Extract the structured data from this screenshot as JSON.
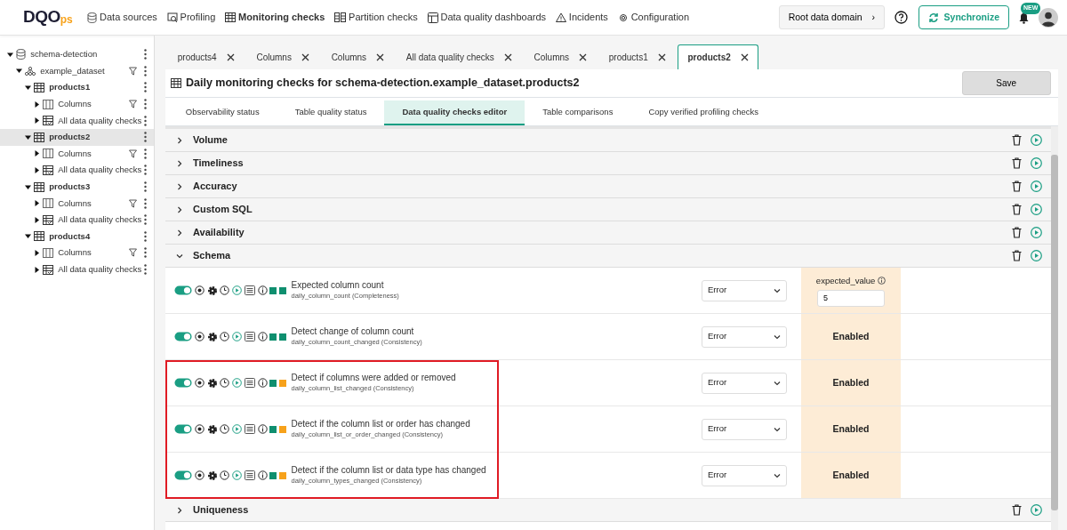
{
  "logo": {
    "main": "DQO",
    "suffix": "ps"
  },
  "nav": [
    {
      "label": "Data sources",
      "selected": false
    },
    {
      "label": "Profiling",
      "selected": false
    },
    {
      "label": "Monitoring checks",
      "selected": true
    },
    {
      "label": "Partition checks",
      "selected": false
    },
    {
      "label": "Data quality dashboards",
      "selected": false
    },
    {
      "label": "Incidents",
      "selected": false
    },
    {
      "label": "Configuration",
      "selected": false
    }
  ],
  "domain_button": {
    "label": "Root data domain",
    "arrow": "›"
  },
  "sync_button": "Synchronize",
  "notification_badge": "NEW",
  "tree": [
    {
      "kind": "connection",
      "label": "schema-detection",
      "expanded": true,
      "selected": false,
      "filter": false,
      "children": [
        {
          "kind": "schema",
          "label": "example_dataset",
          "expanded": true,
          "selected": false,
          "filter": true,
          "children": [
            {
              "kind": "table",
              "label": "products1",
              "expanded": true,
              "selected": false,
              "filter": false,
              "children": [
                {
                  "kind": "columns",
                  "label": "Columns",
                  "expanded": false,
                  "selected": false,
                  "filter": true
                },
                {
                  "kind": "checks",
                  "label": "All data quality checks",
                  "expanded": false,
                  "selected": false,
                  "filter": false
                }
              ]
            },
            {
              "kind": "table",
              "label": "products2",
              "expanded": true,
              "selected": true,
              "filter": false,
              "children": [
                {
                  "kind": "columns",
                  "label": "Columns",
                  "expanded": false,
                  "selected": false,
                  "filter": true
                },
                {
                  "kind": "checks",
                  "label": "All data quality checks",
                  "expanded": false,
                  "selected": false,
                  "filter": false
                }
              ]
            },
            {
              "kind": "table",
              "label": "products3",
              "expanded": true,
              "selected": false,
              "filter": false,
              "children": [
                {
                  "kind": "columns",
                  "label": "Columns",
                  "expanded": false,
                  "selected": false,
                  "filter": true
                },
                {
                  "kind": "checks",
                  "label": "All data quality checks",
                  "expanded": false,
                  "selected": false,
                  "filter": false
                }
              ]
            },
            {
              "kind": "table",
              "label": "products4",
              "expanded": true,
              "selected": false,
              "filter": false,
              "children": [
                {
                  "kind": "columns",
                  "label": "Columns",
                  "expanded": false,
                  "selected": false,
                  "filter": true
                },
                {
                  "kind": "checks",
                  "label": "All data quality checks",
                  "expanded": false,
                  "selected": false,
                  "filter": false
                }
              ]
            }
          ]
        }
      ]
    }
  ],
  "tabs": [
    {
      "label": "products4",
      "selected": false
    },
    {
      "label": "Columns",
      "selected": false
    },
    {
      "label": "Columns",
      "selected": false
    },
    {
      "label": "All data quality checks",
      "selected": false
    },
    {
      "label": "Columns",
      "selected": false
    },
    {
      "label": "products1",
      "selected": false
    },
    {
      "label": "products2",
      "selected": true
    }
  ],
  "page_title": "Daily monitoring checks for schema-detection.example_dataset.products2",
  "save_button": "Save",
  "sub_tabs": [
    {
      "label": "Observability status",
      "selected": false
    },
    {
      "label": "Table quality status",
      "selected": false
    },
    {
      "label": "Data quality checks editor",
      "selected": true
    },
    {
      "label": "Table comparisons",
      "selected": false
    },
    {
      "label": "Copy verified profiling checks",
      "selected": false
    }
  ],
  "categories": [
    {
      "name": "Volume",
      "expanded": false
    },
    {
      "name": "Timeliness",
      "expanded": false
    },
    {
      "name": "Accuracy",
      "expanded": false
    },
    {
      "name": "Custom SQL",
      "expanded": false
    },
    {
      "name": "Availability",
      "expanded": false
    },
    {
      "name": "Schema",
      "expanded": true,
      "checks": [
        {
          "title": "Expected column count",
          "subtitle": "daily_column_count (Completeness)",
          "enabled": true,
          "highlighted": false,
          "status_colors": [
            {
              "color": "#0f8f6f"
            },
            {
              "color": "#0f8f6f"
            }
          ],
          "severity": "Error",
          "rule": {
            "kind": "parameter",
            "label": "expected_value",
            "value": "5"
          }
        },
        {
          "title": "Detect change of column count",
          "subtitle": "daily_column_count_changed (Consistency)",
          "enabled": true,
          "highlighted": false,
          "status_colors": [
            {
              "color": "#0f8f6f"
            },
            {
              "color": "#0f8f6f"
            }
          ],
          "severity": "Error",
          "rule": {
            "kind": "flag",
            "text": "Enabled"
          }
        },
        {
          "title": "Detect if columns were added or removed",
          "subtitle": "daily_column_list_changed (Consistency)",
          "enabled": true,
          "highlighted": true,
          "status_colors": [
            {
              "color": "#0f8f6f"
            },
            {
              "color": "#f7a21b"
            }
          ],
          "severity": "Error",
          "rule": {
            "kind": "flag",
            "text": "Enabled"
          }
        },
        {
          "title": "Detect if the column list or order has changed",
          "subtitle": "daily_column_list_or_order_changed (Consistency)",
          "enabled": true,
          "highlighted": true,
          "status_colors": [
            {
              "color": "#0f8f6f"
            },
            {
              "color": "#f7a21b"
            }
          ],
          "severity": "Error",
          "rule": {
            "kind": "flag",
            "text": "Enabled"
          }
        },
        {
          "title": "Detect if the column list or data type has changed",
          "subtitle": "daily_column_types_changed (Consistency)",
          "enabled": true,
          "highlighted": true,
          "status_colors": [
            {
              "color": "#0f8f6f"
            },
            {
              "color": "#f7a21b"
            }
          ],
          "severity": "Error",
          "rule": {
            "kind": "flag",
            "text": "Enabled"
          }
        }
      ]
    },
    {
      "name": "Uniqueness",
      "expanded": false
    }
  ]
}
